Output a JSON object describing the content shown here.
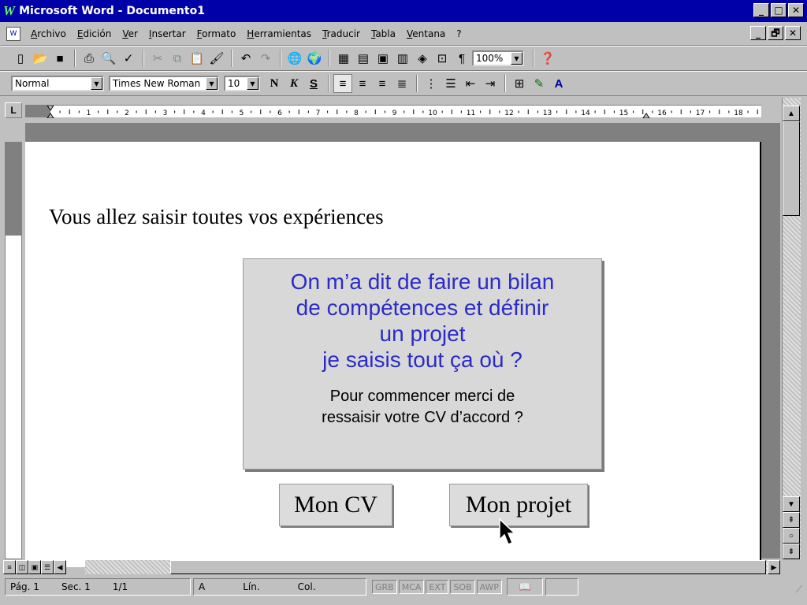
{
  "window": {
    "title": "Microsoft Word - Documento1",
    "app_icon": "W",
    "controls": [
      "_",
      "□",
      "✕"
    ],
    "doc_controls": [
      "_",
      "🗗",
      "✕"
    ]
  },
  "menu": {
    "doc_icon": "W",
    "items": [
      "Archivo",
      "Edición",
      "Ver",
      "Insertar",
      "Formato",
      "Herramientas",
      "Traducir",
      "Tabla",
      "Ventana",
      "?"
    ]
  },
  "toolbar1": {
    "icons": [
      "new-document-icon",
      "open-icon",
      "save-icon",
      "print-icon",
      "print-preview-icon",
      "spelling-icon",
      "cut-icon",
      "copy-icon",
      "paste-icon",
      "format-painter-icon",
      "undo-icon",
      "redo-icon",
      "hyperlink-icon",
      "web-toolbar-icon",
      "tables-borders-icon",
      "insert-table-icon",
      "insert-excel-icon",
      "columns-icon",
      "drawing-icon",
      "document-map-icon",
      "pilcrow-icon",
      "help-icon"
    ],
    "zoom": "100%"
  },
  "toolbar2": {
    "style": "Normal",
    "font": "Times New Roman",
    "size": "10",
    "bold": "N",
    "italic": "K",
    "underline": "S"
  },
  "ruler": {
    "numbers": [
      "1",
      "2",
      "3",
      "4",
      "5",
      "6",
      "7",
      "8",
      "9",
      "10",
      "11",
      "12",
      "13",
      "14",
      "15",
      "16",
      "17",
      "18"
    ],
    "corner": "L"
  },
  "document": {
    "body_text": "Vous allez saisir toutes vos expériences",
    "popup_lines": [
      "On m’a dit de faire un bilan",
      "de compétences et définir",
      "un projet",
      "je saisis tout ça où ?"
    ],
    "popup_sub_lines": [
      "Pour commencer merci de",
      "ressaisir votre CV d’accord ?"
    ],
    "button_cv": "Mon CV",
    "button_projet": "Mon projet"
  },
  "statusbar": {
    "page": "Pág. 1",
    "section": "Sec. 1",
    "pages": "1/1",
    "at": "A",
    "line": "Lín.",
    "col": "Col.",
    "flags": [
      "GRB",
      "MCA",
      "EXT",
      "SOB",
      "AWP"
    ]
  }
}
